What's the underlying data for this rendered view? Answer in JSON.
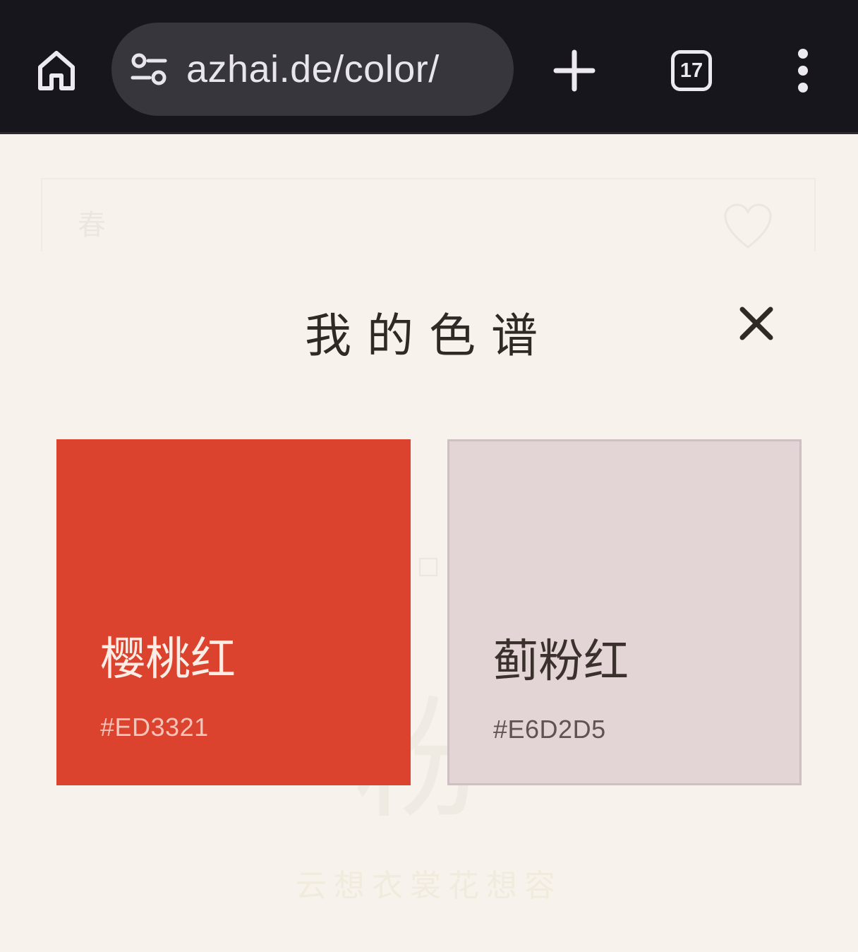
{
  "browser": {
    "url": "azhai.de/color/",
    "tab_count": "17"
  },
  "background": {
    "season_label": "春",
    "big_char": "粉",
    "poem": "云想衣裳花想容"
  },
  "modal": {
    "title": "我的色谱",
    "swatches": [
      {
        "name": "樱桃红",
        "hex": "#ED3321",
        "fill": "#DB432F",
        "text_color": "#F9EDE6",
        "hex_color": "#F4C4B8"
      },
      {
        "name": "蓟粉红",
        "hex": "#E6D2D5",
        "fill": "#E3D4D5",
        "text_color": "#3A302C",
        "hex_color": "#5E5350"
      }
    ]
  },
  "colors": {
    "browser_bar": "#17161C",
    "url_pill": "#38363D",
    "page_bg": "#F7F3EC",
    "title_text": "#2F2A26"
  },
  "icons": [
    "home-icon",
    "site-info-icon",
    "plus-icon",
    "tabs-icon",
    "more-vert-icon",
    "heart-icon",
    "close-icon"
  ]
}
